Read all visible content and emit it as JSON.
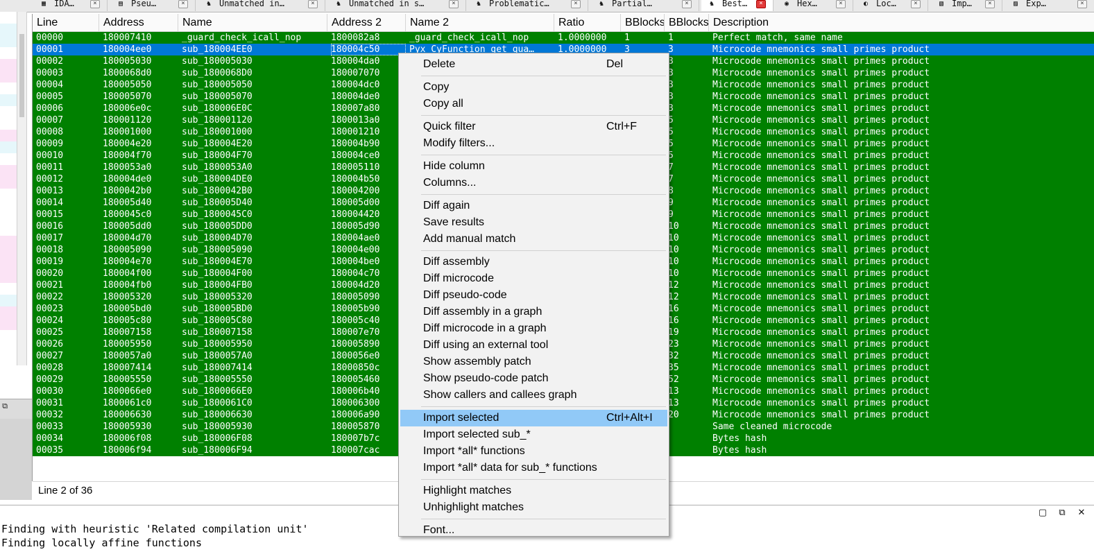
{
  "tabs": [
    {
      "label": "IDA…",
      "icon": "ida-view-icon",
      "active": false
    },
    {
      "label": "Pseu…",
      "icon": "pseudocode-icon",
      "active": false
    },
    {
      "label": "Unmatched in…",
      "icon": "diaphora-icon",
      "active": false
    },
    {
      "label": "Unmatched in s…",
      "icon": "diaphora-icon",
      "active": false
    },
    {
      "label": "Problematic…",
      "icon": "diaphora-icon",
      "active": false
    },
    {
      "label": "Partial…",
      "icon": "diaphora-icon",
      "active": false
    },
    {
      "label": "Best…",
      "icon": "diaphora-icon",
      "active": true
    },
    {
      "label": "Hex…",
      "icon": "hex-view-icon",
      "active": false
    },
    {
      "label": "Loc…",
      "icon": "locals-icon",
      "active": false
    },
    {
      "label": "Imp…",
      "icon": "imports-icon",
      "active": false
    },
    {
      "label": "Exp…",
      "icon": "exports-icon",
      "active": false
    }
  ],
  "columns": [
    "Line",
    "Address",
    "Name",
    "Address 2",
    "Name 2",
    "Ratio",
    "BBlocks",
    "BBlocks",
    "Description"
  ],
  "rows": [
    [
      "00000",
      "180007410",
      "_guard_check_icall_nop",
      "1800082a8",
      "_guard_check_icall_nop",
      "1.0000000",
      "1",
      "1",
      "Perfect match, same name"
    ],
    [
      "00001",
      "180004ee0",
      "sub_180004EE0",
      "180004c50",
      "Pyx_CyFunction_get_qua…",
      "1.0000000",
      "3",
      "3",
      "Microcode mnemonics small primes product"
    ],
    [
      "00002",
      "180005030",
      "sub_180005030",
      "180004da0",
      "",
      "",
      "",
      "3",
      "Microcode mnemonics small primes product"
    ],
    [
      "00003",
      "1800068d0",
      "sub_1800068D0",
      "180007070",
      "",
      "",
      "",
      "3",
      "Microcode mnemonics small primes product"
    ],
    [
      "00004",
      "180005050",
      "sub_180005050",
      "180004dc0",
      "",
      "",
      "",
      "3",
      "Microcode mnemonics small primes product"
    ],
    [
      "00005",
      "180005070",
      "sub_180005070",
      "180004de0",
      "",
      "",
      "",
      "3",
      "Microcode mnemonics small primes product"
    ],
    [
      "00006",
      "180006e0c",
      "sub_180006E0C",
      "180007a80",
      "",
      "",
      "",
      "3",
      "Microcode mnemonics small primes product"
    ],
    [
      "00007",
      "180001120",
      "sub_180001120",
      "1800013a0",
      "",
      "",
      "",
      "5",
      "Microcode mnemonics small primes product"
    ],
    [
      "00008",
      "180001000",
      "sub_180001000",
      "180001210",
      "",
      "",
      "",
      "5",
      "Microcode mnemonics small primes product"
    ],
    [
      "00009",
      "180004e20",
      "sub_180004E20",
      "180004b90",
      "",
      "",
      "",
      "5",
      "Microcode mnemonics small primes product"
    ],
    [
      "00010",
      "180004f70",
      "sub_180004F70",
      "180004ce0",
      "",
      "",
      "",
      "5",
      "Microcode mnemonics small primes product"
    ],
    [
      "00011",
      "1800053a0",
      "sub_1800053A0",
      "180005110",
      "",
      "",
      "",
      "7",
      "Microcode mnemonics small primes product"
    ],
    [
      "00012",
      "180004de0",
      "sub_180004DE0",
      "180004b50",
      "",
      "",
      "",
      "7",
      "Microcode mnemonics small primes product"
    ],
    [
      "00013",
      "1800042b0",
      "sub_1800042B0",
      "180004200",
      "",
      "",
      "",
      "8",
      "Microcode mnemonics small primes product"
    ],
    [
      "00014",
      "180005d40",
      "sub_180005D40",
      "180005d00",
      "",
      "",
      "",
      "9",
      "Microcode mnemonics small primes product"
    ],
    [
      "00015",
      "1800045c0",
      "sub_1800045C0",
      "180004420",
      "",
      "",
      "",
      "9",
      "Microcode mnemonics small primes product"
    ],
    [
      "00016",
      "180005dd0",
      "sub_180005DD0",
      "180005d90",
      "",
      "",
      "",
      "10",
      "Microcode mnemonics small primes product"
    ],
    [
      "00017",
      "180004d70",
      "sub_180004D70",
      "180004ae0",
      "",
      "",
      "",
      "10",
      "Microcode mnemonics small primes product"
    ],
    [
      "00018",
      "180005090",
      "sub_180005090",
      "180004e00",
      "",
      "",
      "",
      "10",
      "Microcode mnemonics small primes product"
    ],
    [
      "00019",
      "180004e70",
      "sub_180004E70",
      "180004be0",
      "",
      "",
      "",
      "10",
      "Microcode mnemonics small primes product"
    ],
    [
      "00020",
      "180004f00",
      "sub_180004F00",
      "180004c70",
      "",
      "",
      "",
      "10",
      "Microcode mnemonics small primes product"
    ],
    [
      "00021",
      "180004fb0",
      "sub_180004FB0",
      "180004d20",
      "",
      "",
      "",
      "12",
      "Microcode mnemonics small primes product"
    ],
    [
      "00022",
      "180005320",
      "sub_180005320",
      "180005090",
      "",
      "",
      "",
      "12",
      "Microcode mnemonics small primes product"
    ],
    [
      "00023",
      "180005bd0",
      "sub_180005BD0",
      "180005b90",
      "",
      "",
      "",
      "16",
      "Microcode mnemonics small primes product"
    ],
    [
      "00024",
      "180005c80",
      "sub_180005C80",
      "180005c40",
      "",
      "",
      "",
      "16",
      "Microcode mnemonics small primes product"
    ],
    [
      "00025",
      "180007158",
      "sub_180007158",
      "180007e70",
      "",
      "",
      "",
      "19",
      "Microcode mnemonics small primes product"
    ],
    [
      "00026",
      "180005950",
      "sub_180005950",
      "180005890",
      "",
      "",
      "",
      "23",
      "Microcode mnemonics small primes product"
    ],
    [
      "00027",
      "1800057a0",
      "sub_1800057A0",
      "1800056e0",
      "",
      "",
      "",
      "32",
      "Microcode mnemonics small primes product"
    ],
    [
      "00028",
      "180007414",
      "sub_180007414",
      "18000850c",
      "",
      "",
      "",
      "35",
      "Microcode mnemonics small primes product"
    ],
    [
      "00029",
      "180005550",
      "sub_180005550",
      "180005460",
      "",
      "",
      "",
      "52",
      "Microcode mnemonics small primes product"
    ],
    [
      "00030",
      "1800066e0",
      "sub_1800066E0",
      "180006b40",
      "",
      "",
      "",
      "13",
      "Microcode mnemonics small primes product"
    ],
    [
      "00031",
      "1800061c0",
      "sub_1800061C0",
      "180006300",
      "",
      "",
      "",
      "13",
      "Microcode mnemonics small primes product"
    ],
    [
      "00032",
      "180006630",
      "sub_180006630",
      "180006a90",
      "",
      "",
      "",
      "20",
      "Microcode mnemonics small primes product"
    ],
    [
      "00033",
      "180005930",
      "sub_180005930",
      "180005870",
      "",
      "",
      "",
      "",
      "Same cleaned microcode"
    ],
    [
      "00034",
      "180006f08",
      "sub_180006F08",
      "180007b7c",
      "",
      "",
      "",
      "",
      "Bytes hash"
    ],
    [
      "00035",
      "180006f94",
      "sub_180006F94",
      "180007cac",
      "",
      "",
      "",
      "",
      "Bytes hash"
    ]
  ],
  "status": "Line 2 of 36",
  "output_lines": [
    "Finding with heuristic 'Related compilation unit'",
    "Finding locally affine functions"
  ],
  "menu_groups": [
    [
      {
        "label": "Delete",
        "shortcut": "Del"
      }
    ],
    [
      {
        "label": "Copy",
        "shortcut": ""
      },
      {
        "label": "Copy all",
        "shortcut": ""
      }
    ],
    [
      {
        "label": "Quick filter",
        "shortcut": "Ctrl+F"
      },
      {
        "label": "Modify filters...",
        "shortcut": ""
      }
    ],
    [
      {
        "label": "Hide column",
        "shortcut": ""
      },
      {
        "label": "Columns...",
        "shortcut": ""
      }
    ],
    [
      {
        "label": "Diff again",
        "shortcut": ""
      },
      {
        "label": "Save results",
        "shortcut": ""
      },
      {
        "label": "Add manual match",
        "shortcut": ""
      }
    ],
    [
      {
        "label": "Diff assembly",
        "shortcut": ""
      },
      {
        "label": "Diff microcode",
        "shortcut": ""
      },
      {
        "label": "Diff pseudo-code",
        "shortcut": ""
      },
      {
        "label": "Diff assembly in a graph",
        "shortcut": ""
      },
      {
        "label": "Diff microcode in a graph",
        "shortcut": ""
      },
      {
        "label": "Diff using an external tool",
        "shortcut": ""
      },
      {
        "label": "Show assembly patch",
        "shortcut": ""
      },
      {
        "label": "Show pseudo-code patch",
        "shortcut": ""
      },
      {
        "label": "Show callers and callees graph",
        "shortcut": ""
      }
    ],
    [
      {
        "label": "Import selected",
        "shortcut": "Ctrl+Alt+I",
        "highlighted": true
      },
      {
        "label": "Import selected sub_*",
        "shortcut": ""
      },
      {
        "label": "Import *all* functions",
        "shortcut": ""
      },
      {
        "label": "Import *all* data for sub_* functions",
        "shortcut": ""
      }
    ],
    [
      {
        "label": "Highlight matches",
        "shortcut": ""
      },
      {
        "label": "Unhighlight matches",
        "shortcut": ""
      }
    ],
    [
      {
        "label": "Font...",
        "shortcut": ""
      }
    ]
  ],
  "colors": {
    "row_green": "#008000",
    "row_selected": "#0078d7",
    "menu_highlight": "#91c9f7"
  },
  "selected_row_index": 1,
  "window_icons": [
    "restore-icon",
    "maximize-icon",
    "close-icon"
  ]
}
